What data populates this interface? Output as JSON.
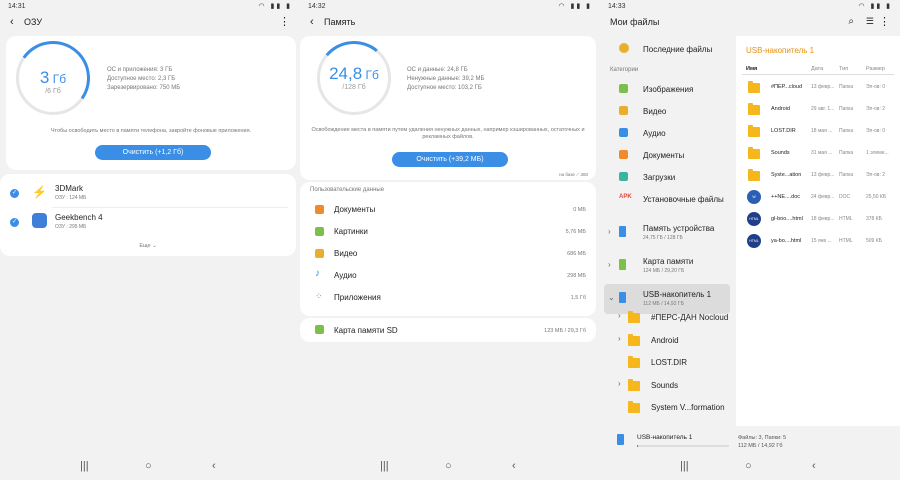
{
  "ram": {
    "time": "14:31",
    "title": "ОЗУ",
    "used_value": "3",
    "used_unit": "Гб",
    "total": "/6 Гб",
    "info": [
      "ОС и приложения: 3 ГБ",
      "Доступное место: 2,3 ГБ",
      "Зарезервировано: 750 МБ"
    ],
    "hint": "Чтобы освободить место в памяти телефона, закройте фоновые приложения.",
    "clean_btn": "Очистить (+1,2 Гб)",
    "apps": [
      {
        "name": "3DMark",
        "sub": "ОЗУ : 124 МБ"
      },
      {
        "name": "Geekbench 4",
        "sub": "ОЗУ : 295 МБ"
      }
    ],
    "more": "Еще"
  },
  "storage": {
    "time": "14:32",
    "title": "Память",
    "used_value": "24,8",
    "used_unit": "Гб",
    "total": "/128 Гб",
    "info": [
      "ОС и данные: 24,8 ГБ",
      "Ненужные данные: 39,2 МБ",
      "Доступное место: 103,2 ГБ"
    ],
    "hint": "Освобождение места в памяти путем удаления ненужных данных, например кэшированных, остаточных и рекламных файлов.",
    "clean_btn": "Очистить (+39,2 МБ)",
    "powered": "на базе  ⟋ 360",
    "section": "Пользовательские данные",
    "items": [
      {
        "name": "Документы",
        "size": "0 МБ",
        "color": "#f08a2c"
      },
      {
        "name": "Картинки",
        "size": "5,76 МБ",
        "color": "#7cc04a"
      },
      {
        "name": "Видео",
        "size": "686 МБ",
        "color": "#e8b02a"
      },
      {
        "name": "Аудио",
        "size": "298 МБ",
        "color": "#3a8ee6"
      },
      {
        "name": "Приложения",
        "size": "1,5 Гб",
        "color": "#4a8ad8"
      }
    ],
    "sd": {
      "name": "Карта памяти SD",
      "size": "123 МБ / 29,3 Гб"
    }
  },
  "files": {
    "time": "14:33",
    "title": "Мои файлы",
    "recent": "Последние файлы",
    "cat_header": "Категории",
    "categories": [
      {
        "name": "Изображения",
        "color": "#7cc04a"
      },
      {
        "name": "Видео",
        "color": "#e8b02a"
      },
      {
        "name": "Аудио",
        "color": "#3a8ee6"
      },
      {
        "name": "Документы",
        "color": "#f08a2c"
      },
      {
        "name": "Загрузки",
        "color": "#3ab5a0"
      },
      {
        "name": "Установочные файлы",
        "color": "#e24a3a",
        "badge": "APK"
      }
    ],
    "locations": [
      {
        "name": "Память устройства",
        "sub": "24,75 ГБ / 128 ГБ",
        "color": "#3a8ee6"
      },
      {
        "name": "Карта памяти",
        "sub": "124 МБ / 29,20 ГБ",
        "color": "#7cc04a"
      },
      {
        "name": "USB-накопитель 1",
        "sub": "112 МБ / 14,92 ГБ",
        "color": "#3a8ee6"
      }
    ],
    "tree": [
      "#ПЕРС-ДАН Nocloud",
      "Android",
      "LOST.DIR",
      "Sounds",
      "System V...formation"
    ],
    "right_title": "USB-накопитель 1",
    "cols": [
      "Имя",
      "Дата",
      "Тип",
      "Размер"
    ],
    "rows": [
      {
        "name": "#ПЕР...cloud",
        "date": "13 февр...",
        "type": "Папка",
        "size": "Эл-ов: 0",
        "kind": "folder"
      },
      {
        "name": "Android",
        "date": "29 авг. 1...",
        "type": "Папка",
        "size": "Эл-ов: 2",
        "kind": "folder"
      },
      {
        "name": "LOST.DIR",
        "date": "18 мая ...",
        "type": "Папка",
        "size": "Эл-ов: 0",
        "kind": "folder"
      },
      {
        "name": "Sounds",
        "date": "31 мая ...",
        "type": "Папка",
        "size": "1 элеме...",
        "kind": "folder"
      },
      {
        "name": "Syste...ation",
        "date": "13 февр...",
        "type": "Папка",
        "size": "Эл-ов: 2",
        "kind": "folder"
      },
      {
        "name": "++NE....doc",
        "date": "24 февр...",
        "type": "DOC",
        "size": "25,50 КБ",
        "kind": "doc",
        "badge": "W"
      },
      {
        "name": "gl-boo....html",
        "date": "18 февр...",
        "type": "HTML",
        "size": "378 КБ",
        "kind": "html",
        "badge": "HTML"
      },
      {
        "name": "ya-bo....html",
        "date": "15 янв ...",
        "type": "HTML",
        "size": "509 КБ",
        "kind": "html",
        "badge": "HTML"
      }
    ],
    "bottom_name": "USB-накопитель 1",
    "bottom_counts": "Файлы: 3, Папки: 5",
    "bottom_size": "112 МБ / 14,92 Гб"
  }
}
